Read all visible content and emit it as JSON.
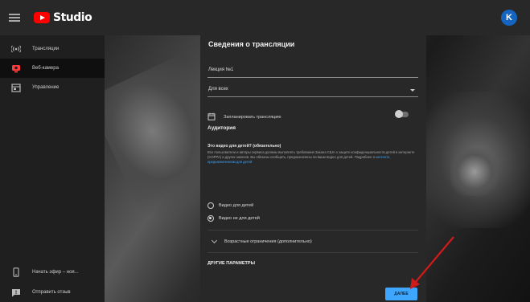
{
  "header": {
    "logo_text": "Studio",
    "avatar_letter": "K",
    "brand_color": "#ff0000",
    "avatar_color": "#1565c0"
  },
  "sidebar": {
    "items": [
      {
        "label": "Трансляции",
        "icon": "broadcast-icon",
        "active": false
      },
      {
        "label": "Веб-камера",
        "icon": "webcam-icon",
        "active": true
      },
      {
        "label": "Управление",
        "icon": "manage-icon",
        "active": false
      }
    ],
    "footer": [
      {
        "label": "Начать эфир – ноя...",
        "icon": "mobile-icon"
      },
      {
        "label": "Отправить отзыв",
        "icon": "feedback-icon"
      }
    ]
  },
  "dialog": {
    "title": "Сведения о трансляции",
    "title_field": {
      "value": "Лекция №1"
    },
    "privacy_select": {
      "value": "Для всех"
    },
    "schedule": {
      "label": "Запланировать трансляцию",
      "enabled": false
    },
    "audience": {
      "heading": "Аудитория",
      "question": "Это видео для детей? (обязательно)",
      "description": "Все пользователи и авторы сервиса должны выполнять требования Закона США о защите конфиденциальности детей в интернете (COPPA) и других законов. Вы обязаны сообщить, предназначены ли ваши видео для детей. Подробнее о",
      "link": "контенте, предназначенном для детей",
      "options": [
        {
          "label": "Видео для детей",
          "checked": false
        },
        {
          "label": "Видео не для детей",
          "checked": true
        }
      ]
    },
    "age_restriction": {
      "label": "Возрастные ограничения (дополнительно)"
    },
    "other_params": {
      "heading": "ДРУГИЕ ПАРАМЕТРЫ"
    },
    "done_button": {
      "label": "ДАЛЕЕ"
    }
  },
  "colors": {
    "accent": "#3ea6ff",
    "arrow": "#d11a1a",
    "dialog_bg": "#282828",
    "sidebar_bg": "#1f1f1f",
    "topbar_bg": "#282828"
  }
}
